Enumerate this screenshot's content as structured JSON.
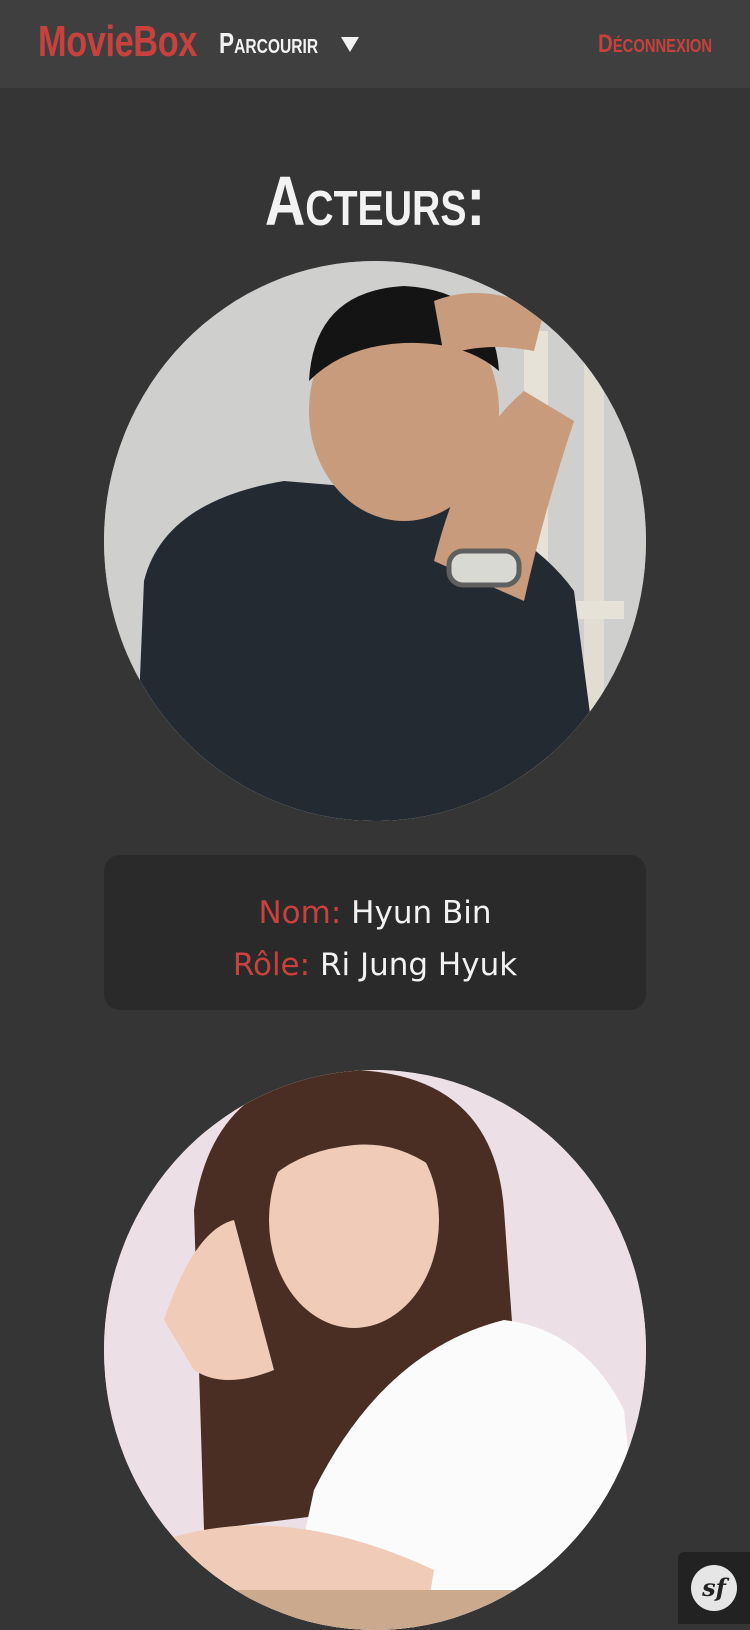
{
  "navbar": {
    "brand": "MovieBox",
    "browse_label": "Parcourir",
    "logout_label": "Déconnexion"
  },
  "page": {
    "title": "Acteurs:"
  },
  "actors": [
    {
      "name_label": "Nom:",
      "name": "Hyun Bin",
      "role_label": "Rôle:",
      "role": "Ri Jung Hyuk"
    }
  ],
  "debug_toolbar": {
    "logo_text": "sf"
  },
  "colors": {
    "accent": "#c8413d",
    "background": "#353535",
    "navbar": "#3f3f3f",
    "card": "#2a2a2a",
    "text": "#f2f2f2"
  },
  "icons": {
    "browse_dropdown": "caret-down-icon",
    "toolbar": "symfony-logo-icon"
  }
}
